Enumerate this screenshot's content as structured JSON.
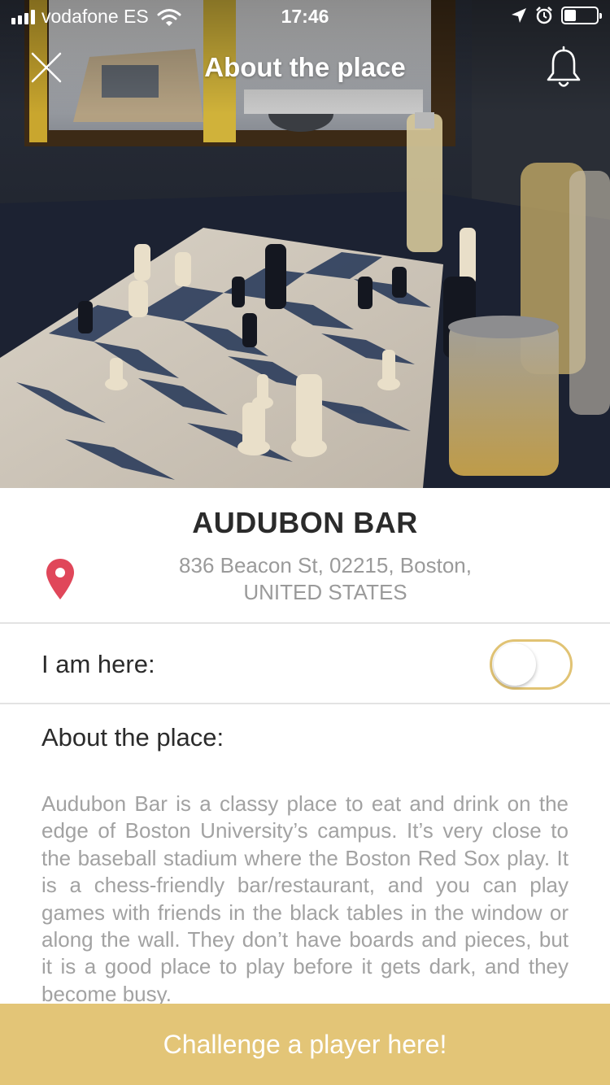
{
  "status_bar": {
    "carrier": "vodafone ES",
    "time": "17:46"
  },
  "nav": {
    "title": "About the place",
    "close_icon": "close-icon",
    "bell_icon": "bell-icon"
  },
  "place": {
    "name": "AUDUBON BAR",
    "address_line1": "836 Beacon St, 02215, Boston,",
    "address_line2": "UNITED STATES",
    "pin_icon": "map-pin-icon"
  },
  "presence": {
    "label": "I am here:",
    "toggle_on": false
  },
  "about": {
    "heading": "About the place:",
    "text": "Audubon Bar is a classy place to eat and drink on the edge of Boston University’s campus. It’s very close to the baseball stadium where the Boston Red Sox play. It is a chess-friendly bar/restaurant, and you can play games with friends in the black tables in the window or along the wall. They don’t have boards and pieces, but it is a good place to play before it gets dark, and they become busy."
  },
  "cta": {
    "label": "Challenge a player here!"
  },
  "colors": {
    "accent": "#e3c577",
    "pin": "#e0475a",
    "text_dark": "#2b2b2b",
    "text_muted": "#a2a2a2"
  }
}
